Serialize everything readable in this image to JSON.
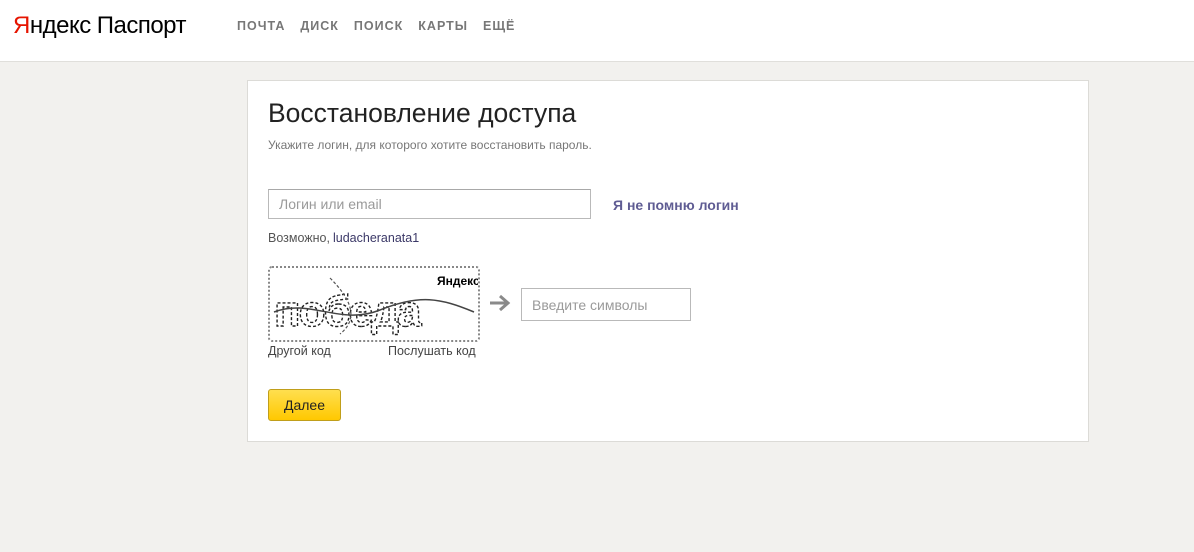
{
  "header": {
    "logo_brand_first": "Я",
    "logo_brand_rest": "ндекс",
    "logo_service": "Паспорт",
    "nav": [
      "ПОЧТА",
      "ДИСК",
      "ПОИСК",
      "КАРТЫ",
      "ЕЩЁ"
    ]
  },
  "form": {
    "title": "Восстановление доступа",
    "subtitle": "Укажите логин, для которого хотите восстановить пароль.",
    "login_placeholder": "Логин или email",
    "login_value": "",
    "forgot_login_link": "Я не помню логин",
    "maybe_label": "Возможно,",
    "maybe_suggestion": "ludacheranata1",
    "captcha": {
      "image_brand": "Яндекс",
      "image_text": "победа",
      "input_placeholder": "Введите символы",
      "other_code_link": "Другой код",
      "listen_code_link": "Послушать код"
    },
    "submit_label": "Далее"
  },
  "colors": {
    "brand_red": "#e61400",
    "link_purple": "#5f5c93",
    "button_yellow": "#ffd52e",
    "page_background": "#f2f1ee"
  },
  "icons": [
    "arrow-right-icon"
  ]
}
